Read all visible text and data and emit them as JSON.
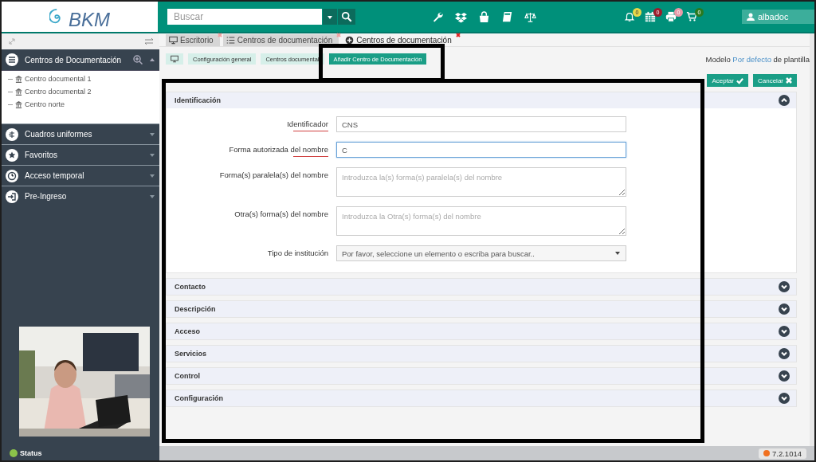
{
  "header": {
    "logo": "BKM",
    "search": {
      "placeholder": "Buscar"
    },
    "notifications": [
      {
        "kind": "bell",
        "count": "0",
        "color": "#e8d84a"
      },
      {
        "kind": "calendar",
        "count": "0",
        "color": "#9c1c2c"
      },
      {
        "kind": "printer",
        "count": "0",
        "color": "#e89aa8"
      },
      {
        "kind": "cart",
        "count": "0",
        "color": "#2a7a20"
      }
    ],
    "user": "albadoc"
  },
  "sidebar": {
    "tree": {
      "title": "Centros de Documentación",
      "expanded": true,
      "children": [
        {
          "label": "Centro documental 1"
        },
        {
          "label": "Centro documental 2"
        },
        {
          "label": "Centro norte"
        }
      ]
    },
    "sections": [
      {
        "kind": "scheme",
        "label": "Cuadros uniformes"
      },
      {
        "kind": "star",
        "label": "Favoritos"
      },
      {
        "kind": "clock",
        "label": "Acceso temporal"
      },
      {
        "kind": "signin",
        "label": "Pre-Ingreso"
      }
    ],
    "status": "Status"
  },
  "tabs": [
    {
      "kind": "desktop",
      "label": "Escritorio",
      "selected": false
    },
    {
      "kind": "list",
      "label": "Centros de documentación",
      "selected": false
    },
    {
      "kind": "add",
      "label": "Centros de documentación",
      "selected": true
    }
  ],
  "breadcrumb": [
    {
      "label": "Configuración general",
      "selected": false
    },
    {
      "label": "Centros documental",
      "selected": false
    },
    {
      "label": "Añadir Centro de Documentación",
      "selected": true
    }
  ],
  "template": {
    "label": "Modelo",
    "link": "Por defecto",
    "suffix": "de plantilla"
  },
  "buttons": [
    {
      "kind": "accept",
      "label": "Aceptar"
    },
    {
      "kind": "cancel",
      "label": "Cancelar"
    }
  ],
  "sections": [
    {
      "title": "Identificación",
      "expanded": true,
      "fields": [
        {
          "kind": "text",
          "label": "Identificador",
          "required": true,
          "value": "CNS",
          "focused": false
        },
        {
          "kind": "text",
          "label": "Forma autorizada del nombre",
          "required": true,
          "value": "C",
          "focused": true
        },
        {
          "kind": "textarea",
          "label": "Forma(s) paralela(s) del nombre",
          "required": false,
          "placeholder": "Introduzca la(s) forma(s) paralela(s) del nombre"
        },
        {
          "kind": "textarea",
          "label": "Otra(s) forma(s) del nombre",
          "required": false,
          "placeholder": "Introduzca la Otra(s) forma(s) del nombre"
        },
        {
          "kind": "select",
          "label": "Tipo de institución",
          "required": false,
          "placeholder": "Por favor, seleccione un elemento o escriba para buscar.."
        }
      ]
    },
    {
      "title": "Contacto",
      "expanded": false
    },
    {
      "title": "Descripción",
      "expanded": false
    },
    {
      "title": "Acceso",
      "expanded": false
    },
    {
      "title": "Servicios",
      "expanded": false
    },
    {
      "title": "Control",
      "expanded": false
    },
    {
      "title": "Configuración",
      "expanded": false
    }
  ],
  "version": "7.2.1014"
}
